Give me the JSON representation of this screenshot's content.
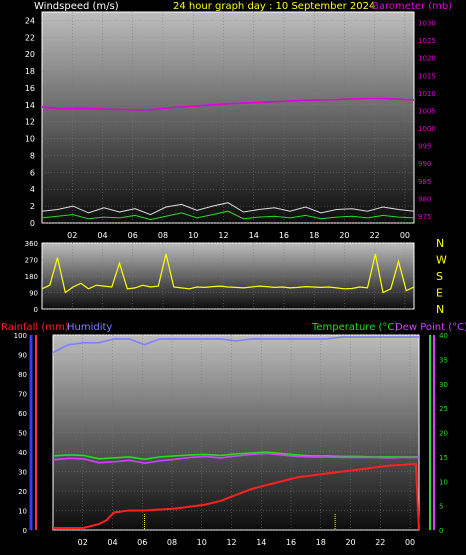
{
  "header": {
    "windspeed_label": "Windspeed (m/s)",
    "title": "24 hour graph day : 10 September 2024",
    "barometer_label": "Barometer (mb)"
  },
  "colors": {
    "windspeed": "#ffffff",
    "barometer": "#dd00dd",
    "direction": "#ffff00",
    "rainfall": "#ff2020",
    "humidity": "#8080ff",
    "temperature": "#22dd22",
    "dewpoint": "#cc44ff",
    "panel_top": "#bdbdbd",
    "panel_bottom": "#0c0c0c"
  },
  "chart_data": [
    {
      "type": "line",
      "name": "wind-barometer",
      "x_ticks": [
        "02",
        "04",
        "06",
        "08",
        "10",
        "12",
        "14",
        "16",
        "18",
        "20",
        "22",
        "00"
      ],
      "xlabel": "",
      "ylabel": "Windspeed (m/s)",
      "ylim": [
        0,
        25
      ],
      "yticks": [
        "0",
        "2",
        "4",
        "6",
        "8",
        "10",
        "12",
        "14",
        "16",
        "18",
        "20",
        "22",
        "24"
      ],
      "y2label": "Barometer (mb)",
      "y2lim": [
        973,
        1033
      ],
      "y2ticks": [
        "975",
        "980",
        "985",
        "990",
        "995",
        "1000",
        "1005",
        "1010",
        "1015",
        "1020",
        "1025",
        "1030"
      ],
      "series": [
        {
          "name": "Barometer (mb)",
          "axis": "right",
          "x": [
            0,
            1,
            2,
            3,
            4,
            5,
            6,
            7,
            8,
            9,
            10,
            11,
            12,
            13,
            14,
            15,
            16,
            17,
            18,
            19,
            20,
            21,
            22,
            23,
            24
          ],
          "values": [
            1006.0,
            1005.5,
            1005.6,
            1005.6,
            1005.4,
            1005.3,
            1005.2,
            1005.2,
            1005.7,
            1006.0,
            1006.3,
            1006.6,
            1006.9,
            1007.1,
            1007.3,
            1007.5,
            1007.7,
            1007.9,
            1008.0,
            1008.1,
            1008.3,
            1008.4,
            1008.4,
            1008.2,
            1008.0
          ]
        },
        {
          "name": "Windspeed (m/s)",
          "axis": "left",
          "x": [
            0,
            1,
            2,
            3,
            4,
            5,
            6,
            7,
            8,
            9,
            10,
            11,
            12,
            13,
            14,
            15,
            16,
            17,
            18,
            19,
            20,
            21,
            22,
            23,
            24
          ],
          "values": [
            0.6,
            0.8,
            1.0,
            0.5,
            0.7,
            0.6,
            0.9,
            0.4,
            0.8,
            1.2,
            0.6,
            1.0,
            1.4,
            0.5,
            0.7,
            0.8,
            0.6,
            0.9,
            0.5,
            0.7,
            0.8,
            0.6,
            0.9,
            0.7,
            0.6
          ]
        },
        {
          "name": "Wind gust",
          "axis": "left",
          "x": [
            0,
            1,
            2,
            3,
            4,
            5,
            6,
            7,
            8,
            9,
            10,
            11,
            12,
            13,
            14,
            15,
            16,
            17,
            18,
            19,
            20,
            21,
            22,
            23,
            24
          ],
          "values": [
            1.4,
            1.6,
            2.0,
            1.2,
            1.8,
            1.3,
            1.7,
            1.0,
            1.9,
            2.2,
            1.5,
            2.0,
            2.4,
            1.3,
            1.6,
            1.8,
            1.4,
            1.9,
            1.2,
            1.6,
            1.7,
            1.4,
            1.9,
            1.6,
            1.4
          ]
        }
      ]
    },
    {
      "type": "line",
      "name": "wind-direction",
      "x_ticks": [
        "02",
        "04",
        "06",
        "08",
        "10",
        "12",
        "14",
        "16",
        "18",
        "20",
        "22",
        "00"
      ],
      "ylim": [
        0,
        360
      ],
      "yticks": [
        "0",
        "90",
        "180",
        "270",
        "360"
      ],
      "right_labels": [
        "N",
        "W",
        "S",
        "E",
        "N"
      ],
      "series": [
        {
          "name": "Wind direction",
          "x": [
            0,
            0.5,
            1,
            1.5,
            2,
            2.5,
            3,
            3.5,
            4,
            4.5,
            5,
            5.5,
            6,
            6.5,
            7,
            7.5,
            8,
            8.5,
            9,
            9.5,
            10,
            10.5,
            11,
            11.5,
            12,
            12.5,
            13,
            13.5,
            14,
            14.5,
            15,
            15.5,
            16,
            16.5,
            17,
            17.5,
            18,
            18.5,
            19,
            19.5,
            20,
            20.5,
            21,
            21.5,
            22,
            22.5,
            23,
            23.5,
            24
          ],
          "values": [
            110,
            130,
            280,
            90,
            120,
            140,
            110,
            130,
            125,
            120,
            250,
            110,
            115,
            130,
            120,
            125,
            300,
            120,
            115,
            110,
            120,
            118,
            122,
            125,
            120,
            118,
            115,
            120,
            125,
            122,
            118,
            120,
            115,
            118,
            122,
            120,
            118,
            120,
            115,
            110,
            112,
            120,
            115,
            300,
            90,
            110,
            260,
            100,
            120
          ]
        }
      ]
    },
    {
      "type": "line",
      "name": "rain-humidity-temp",
      "header_labels": {
        "rainfall": "Rainfall (mm)",
        "humidity": "Humidity",
        "temperature": "Temperature (°C)",
        "dewpoint": "Dew Point (°C)"
      },
      "x_ticks": [
        "02",
        "04",
        "06",
        "08",
        "10",
        "12",
        "14",
        "16",
        "18",
        "20",
        "22",
        "00"
      ],
      "ylim": [
        0,
        100
      ],
      "yticks": [
        "0",
        "10",
        "20",
        "30",
        "40",
        "50",
        "60",
        "70",
        "80",
        "90",
        "100"
      ],
      "y2lim": [
        0,
        40
      ],
      "y2ticks": [
        "0",
        "5",
        "10",
        "15",
        "20",
        "25",
        "30",
        "35",
        "40"
      ],
      "series": [
        {
          "name": "Humidity",
          "axis": "left",
          "x": [
            0,
            1,
            2,
            3,
            4,
            5,
            6,
            7,
            8,
            9,
            10,
            11,
            12,
            13,
            14,
            15,
            16,
            17,
            18,
            19,
            20,
            21,
            22,
            23,
            24
          ],
          "values": [
            91,
            95,
            96,
            96,
            98,
            98,
            95,
            98,
            98,
            98,
            98,
            98,
            97,
            98,
            98,
            98,
            98,
            98,
            98,
            99,
            99,
            99,
            99,
            99,
            99
          ]
        },
        {
          "name": "Rainfall (mm)",
          "axis": "left",
          "x": [
            0,
            1,
            2,
            3,
            3.5,
            4,
            5,
            6,
            7,
            8,
            9,
            10,
            11,
            12,
            13,
            14,
            15,
            16,
            17,
            18,
            19,
            20,
            21,
            22,
            23,
            23.8,
            24
          ],
          "values": [
            1,
            1,
            1,
            3,
            5,
            9,
            10,
            10,
            10.5,
            11,
            12,
            13,
            15,
            18,
            21,
            23,
            25,
            27,
            28,
            29,
            30,
            31,
            32,
            33,
            33.5,
            34,
            0
          ]
        },
        {
          "name": "Temperature (°C)",
          "axis": "right",
          "x": [
            0,
            1,
            2,
            3,
            4,
            5,
            6,
            7,
            8,
            9,
            10,
            11,
            12,
            13,
            14,
            15,
            16,
            17,
            18,
            19,
            20,
            21,
            22,
            23,
            24
          ],
          "values": [
            15.2,
            15.4,
            15.3,
            14.6,
            14.8,
            15.0,
            14.5,
            15.0,
            15.2,
            15.4,
            15.5,
            15.3,
            15.6,
            15.8,
            16.0,
            15.7,
            15.4,
            15.2,
            15.2,
            15.1,
            15.1,
            15.0,
            15.0,
            15.0,
            15.0
          ]
        },
        {
          "name": "Dew Point (°C)",
          "axis": "right",
          "x": [
            0,
            1,
            2,
            3,
            4,
            5,
            6,
            7,
            8,
            9,
            10,
            11,
            12,
            13,
            14,
            15,
            16,
            17,
            18,
            19,
            20,
            21,
            22,
            23,
            24
          ],
          "values": [
            14.4,
            14.7,
            14.6,
            13.8,
            14.0,
            14.3,
            13.7,
            14.2,
            14.5,
            14.9,
            15.1,
            14.8,
            15.2,
            15.5,
            15.7,
            15.4,
            15.1,
            15.0,
            15.0,
            14.9,
            14.9,
            14.9,
            14.8,
            14.9,
            14.9
          ]
        }
      ]
    }
  ]
}
